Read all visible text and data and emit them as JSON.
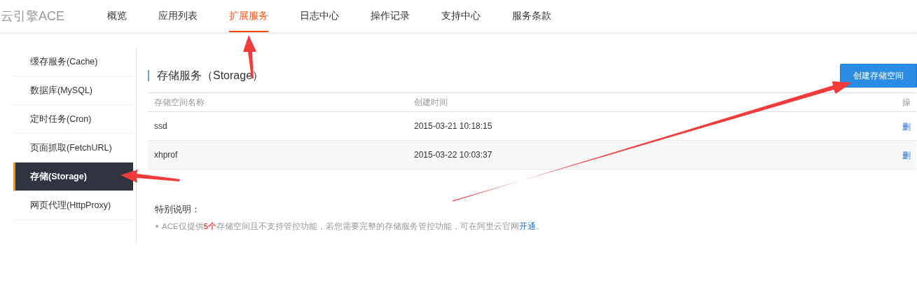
{
  "logo": "云引擎ACE",
  "nav": [
    {
      "label": "概览",
      "selected": false
    },
    {
      "label": "应用列表",
      "selected": false
    },
    {
      "label": "扩展服务",
      "selected": true
    },
    {
      "label": "日志中心",
      "selected": false
    },
    {
      "label": "操作记录",
      "selected": false
    },
    {
      "label": "支持中心",
      "selected": false
    },
    {
      "label": "服务条款",
      "selected": false
    }
  ],
  "sidebar": {
    "items": [
      {
        "label": "缓存服务(Cache)",
        "selected": false
      },
      {
        "label": "数据库(MySQL)",
        "selected": false
      },
      {
        "label": "定时任务(Cron)",
        "selected": false
      },
      {
        "label": "页面抓取(FetchURL)",
        "selected": false
      },
      {
        "label": "存储(Storage)",
        "selected": true
      },
      {
        "label": "网页代理(HttpProxy)",
        "selected": false
      }
    ]
  },
  "page_title": "存储服务（Storage）",
  "create_button": "创建存储空间",
  "table": {
    "columns": [
      "存储空间名称",
      "创建时间",
      "操"
    ],
    "rows": [
      {
        "cells": [
          "ssd",
          "2015-03-21 10:18:15"
        ],
        "action": "删"
      },
      {
        "cells": [
          "xhprof",
          "2015-03-22 10:03:37"
        ],
        "action": "删"
      }
    ]
  },
  "note": {
    "title": "特别说明：",
    "parts": [
      {
        "kind": "text",
        "text": "ACE仅提供"
      },
      {
        "kind": "highlight",
        "text": "5个"
      },
      {
        "kind": "text",
        "text": "存储空间且不支持管控功能，若您需要完整的存储服务管控功能，可在阿里云官网"
      },
      {
        "kind": "link",
        "text": "开通"
      },
      {
        "kind": "text",
        "text": "。"
      }
    ]
  }
}
